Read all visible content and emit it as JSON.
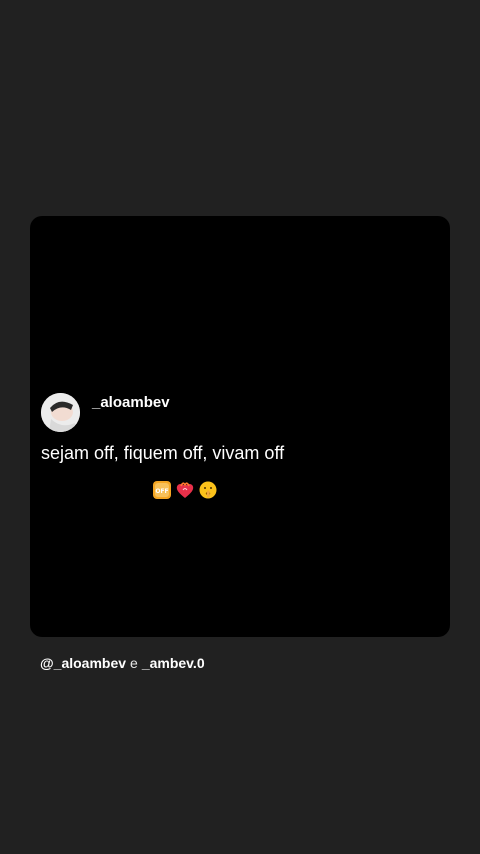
{
  "post": {
    "author": "_aloambev",
    "text": "sejam off, fiquem off, vivam off",
    "emojis": [
      "off-button-emoji",
      "heart-on-fire-emoji",
      "shushing-face-emoji"
    ]
  },
  "mentions": {
    "first": "@_aloambev",
    "conjunction": "e",
    "second": "_ambev.0"
  },
  "colors": {
    "background": "#212121",
    "card": "#000000",
    "text": "#ffffff"
  }
}
